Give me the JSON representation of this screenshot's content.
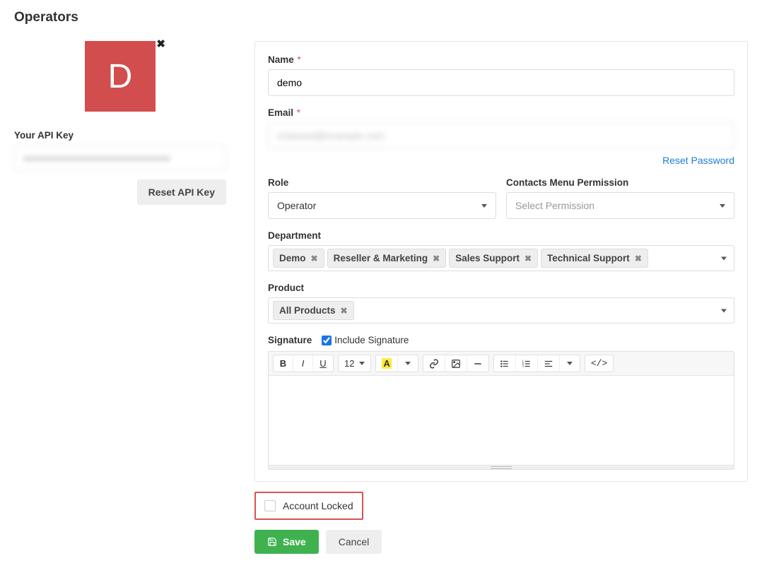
{
  "page": {
    "title": "Operators"
  },
  "sidebar": {
    "avatar_letter": "D",
    "api_key_label": "Your API Key",
    "api_key_value": "xxxxxxxxxxxxxxxxxxxxxxxxxxxxxxxx",
    "reset_api_key_label": "Reset API Key"
  },
  "form": {
    "name": {
      "label": "Name",
      "value": "demo"
    },
    "email": {
      "label": "Email",
      "value": "redacted@example.com"
    },
    "reset_password_label": "Reset Password",
    "role": {
      "label": "Role",
      "selected": "Operator"
    },
    "contacts_permission": {
      "label": "Contacts Menu Permission",
      "placeholder": "Select Permission"
    },
    "department": {
      "label": "Department",
      "tags": [
        "Demo",
        "Reseller & Marketing",
        "Sales Support",
        "Technical Support"
      ]
    },
    "product": {
      "label": "Product",
      "tags": [
        "All Products"
      ]
    },
    "signature": {
      "label": "Signature",
      "include_label": "Include Signature",
      "include_checked": true,
      "font_size": "12"
    },
    "account_locked": {
      "label": "Account Locked",
      "checked": false
    },
    "save_label": "Save",
    "cancel_label": "Cancel"
  }
}
